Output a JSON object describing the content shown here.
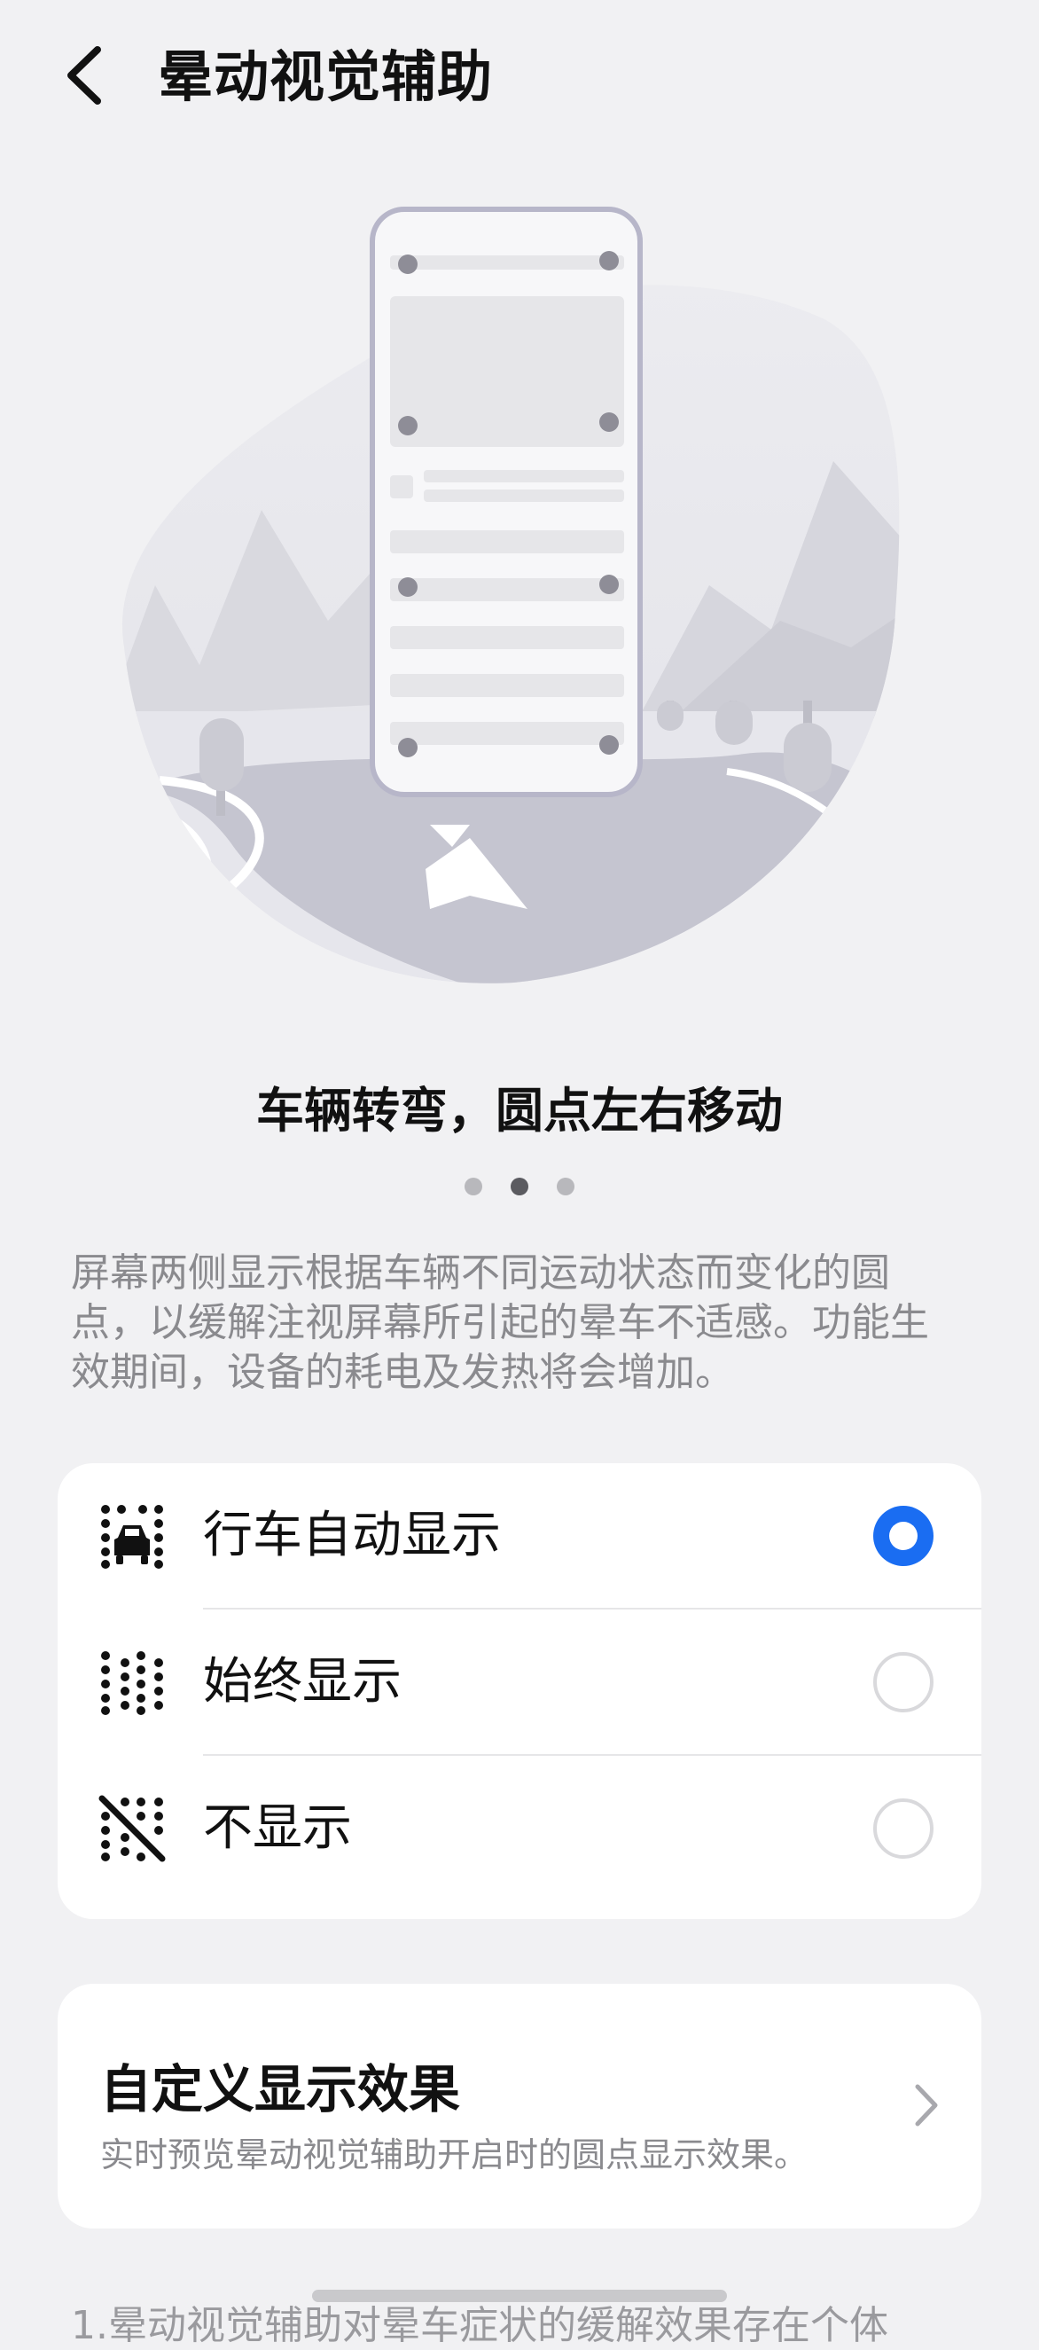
{
  "header": {
    "title": "晕动视觉辅助",
    "back_icon": "chevron-left-icon"
  },
  "illustration": {
    "description_icon": "phone-on-road-illustration"
  },
  "caption": "车辆转弯，圆点左右移动",
  "pager": {
    "count": 3,
    "active_index": 1
  },
  "description": "屏幕两侧显示根据车辆不同运动状态而变化的圆点，以缓解注视屏幕所引起的晕车不适感。功能生效期间，设备的耗电及发热将会增加。",
  "options": [
    {
      "label": "行车自动显示",
      "icon": "car-dots-icon",
      "selected": true
    },
    {
      "label": "始终显示",
      "icon": "dots-grid-icon",
      "selected": false
    },
    {
      "label": "不显示",
      "icon": "dots-off-icon",
      "selected": false
    }
  ],
  "custom_effect": {
    "title": "自定义显示效果",
    "subtitle": "实时预览晕动视觉辅助开启时的圆点显示效果。"
  },
  "footnote": "1.晕动视觉辅助对晕车症状的缓解效果存在个体",
  "colors": {
    "accent": "#1a6df2",
    "background": "#f1f1f3",
    "card": "#ffffff",
    "secondary_text": "#8a8a8e"
  }
}
